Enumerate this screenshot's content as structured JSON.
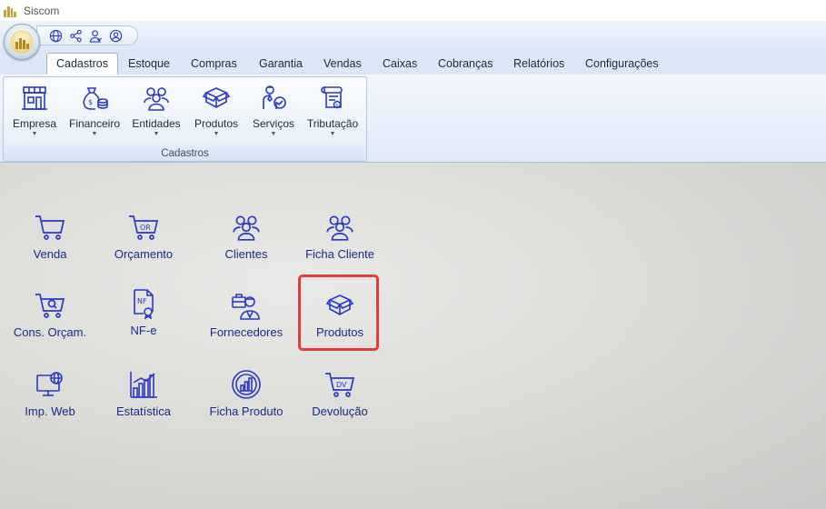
{
  "window": {
    "title": "Siscom"
  },
  "colors": {
    "accent": "#2b38c8",
    "highlight": "#e03c3c",
    "ribbon_bg": "#dbe7f6"
  },
  "quick_access": {
    "icons": [
      "globe-icon",
      "network-icon",
      "user-check-icon",
      "user-circle-icon"
    ]
  },
  "tabs": [
    {
      "label": "Cadastros",
      "active": true
    },
    {
      "label": "Estoque"
    },
    {
      "label": "Compras"
    },
    {
      "label": "Garantia"
    },
    {
      "label": "Vendas"
    },
    {
      "label": "Caixas"
    },
    {
      "label": "Cobranças"
    },
    {
      "label": "Relatórios"
    },
    {
      "label": "Configurações"
    }
  ],
  "ribbon_group": {
    "label": "Cadastros",
    "buttons": [
      {
        "label": "Empresa",
        "icon": "store-icon"
      },
      {
        "label": "Financeiro",
        "icon": "money-bag-icon"
      },
      {
        "label": "Entidades",
        "icon": "users-icon"
      },
      {
        "label": "Produtos",
        "icon": "boxes-icon"
      },
      {
        "label": "Serviços",
        "icon": "service-person-icon"
      },
      {
        "label": "Tributação",
        "icon": "tax-document-icon"
      }
    ]
  },
  "shortcuts": [
    {
      "label": "Venda",
      "icon": "cart-icon"
    },
    {
      "label": "Orçamento",
      "icon": "cart-or-icon"
    },
    {
      "label": "Clientes",
      "icon": "users-icon"
    },
    {
      "label": "Ficha Cliente",
      "icon": "users-icon"
    },
    {
      "label": "Cons. Orçam.",
      "icon": "cart-search-icon"
    },
    {
      "label": "NF-e",
      "icon": "nfe-document-icon"
    },
    {
      "label": "Fornecedores",
      "icon": "supplier-icon"
    },
    {
      "label": "Produtos",
      "icon": "boxes-icon",
      "highlighted": true
    },
    {
      "label": "Imp. Web",
      "icon": "monitor-globe-icon"
    },
    {
      "label": "Estatística",
      "icon": "bar-chart-icon"
    },
    {
      "label": "Ficha Produto",
      "icon": "chart-circle-icon"
    },
    {
      "label": "Devolução",
      "icon": "cart-dv-icon"
    }
  ],
  "icon_text": {
    "or": "OR",
    "nf": "NF",
    "dv": "DV"
  }
}
